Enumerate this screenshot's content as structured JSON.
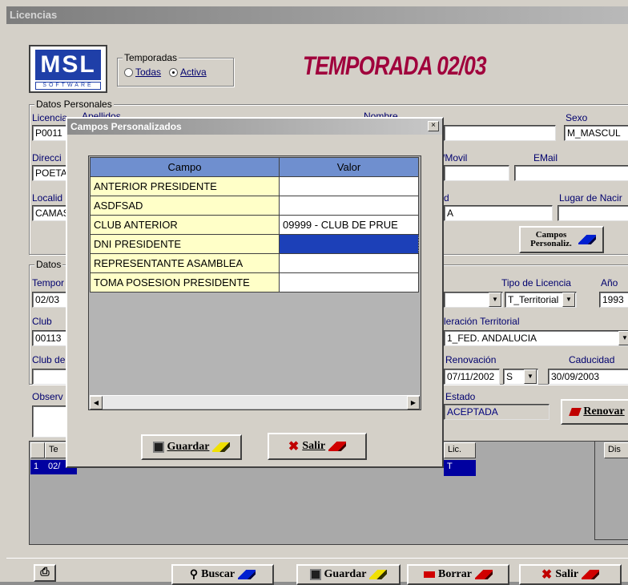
{
  "window": {
    "title": "Licencias"
  },
  "banner": {
    "logo_text": "MSL",
    "logo_sub": "SOFTWARE",
    "season_heading": "TEMPORADA 02/03",
    "temporadas": {
      "legend": "Temporadas",
      "options": [
        "Todas",
        "Activa"
      ],
      "selected": "Activa"
    }
  },
  "datos_personales": {
    "legend": "Datos Personales",
    "licencia_label": "Licencia",
    "licencia_value": "P0011",
    "apellidos_label": "Apellidos",
    "nombre_label": "Nombre",
    "sexo_label": "Sexo",
    "sexo_value": "M_MASCUL",
    "direccion_label": "Direcci",
    "direccion_value": "POETA",
    "movil_label": "/Movil",
    "email_label": "EMail",
    "localidad_label": "Localid",
    "localidad_value": "CAMAS",
    "provincia_label": "d",
    "provincia_value": "A",
    "lugar_nac_label": "Lugar de Nacir",
    "campos_button": "Campos Personaliz."
  },
  "datos": {
    "legend": "Datos",
    "temporada_label": "Tempor",
    "temporada_value": "02/03",
    "tipo_licencia_label": "Tipo de Licencia",
    "tipo_licencia_value": "T_Territorial",
    "anio_label": "Año",
    "anio_value": "1993",
    "club_label": "Club",
    "club_value": "00113",
    "federacion_label": "leración Territorial",
    "federacion_value": "1_FED. ANDALUCIA",
    "club_destino_label": "Club de",
    "renovacion_label": "Renovación",
    "renovacion_value": "07/11/2002",
    "renov_s_value": "S",
    "caducidad_label": "Caducidad",
    "caducidad_value": "30/09/2003",
    "observ_label": "Observ",
    "estado_label": "Estado",
    "estado_value": "ACEPTADA",
    "renovar_button": "Renovar"
  },
  "lower_grid": {
    "header_1": "Te",
    "row_num": "1",
    "row_val": "02/",
    "lic_header": "Lic.",
    "lic_value": "T",
    "dis_header": "Dis"
  },
  "toolbar": {
    "buscar": "Buscar",
    "guardar": "Guardar",
    "borrar": "Borrar",
    "salir": "Salir"
  },
  "dialog": {
    "title": "Campos Personalizados",
    "close_glyph": "×",
    "columns": [
      "Campo",
      "Valor"
    ],
    "rows": [
      {
        "campo": "ANTERIOR PRESIDENTE",
        "valor": ""
      },
      {
        "campo": "ASDFSAD",
        "valor": ""
      },
      {
        "campo": "CLUB ANTERIOR",
        "valor": "09999 - CLUB DE PRUE"
      },
      {
        "campo": "DNI PRESIDENTE",
        "valor": ""
      },
      {
        "campo": "REPRESENTANTE ASAMBLEA",
        "valor": ""
      },
      {
        "campo": "TOMA POSESION PRESIDENTE",
        "valor": ""
      }
    ],
    "selected_row": 3,
    "guardar": "Guardar",
    "salir": "Salir"
  },
  "colors": {
    "grid_header": "#6f8fcf",
    "campo_cell": "#ffffc8",
    "selected": "#1c40b8",
    "heading": "#a0003c"
  }
}
